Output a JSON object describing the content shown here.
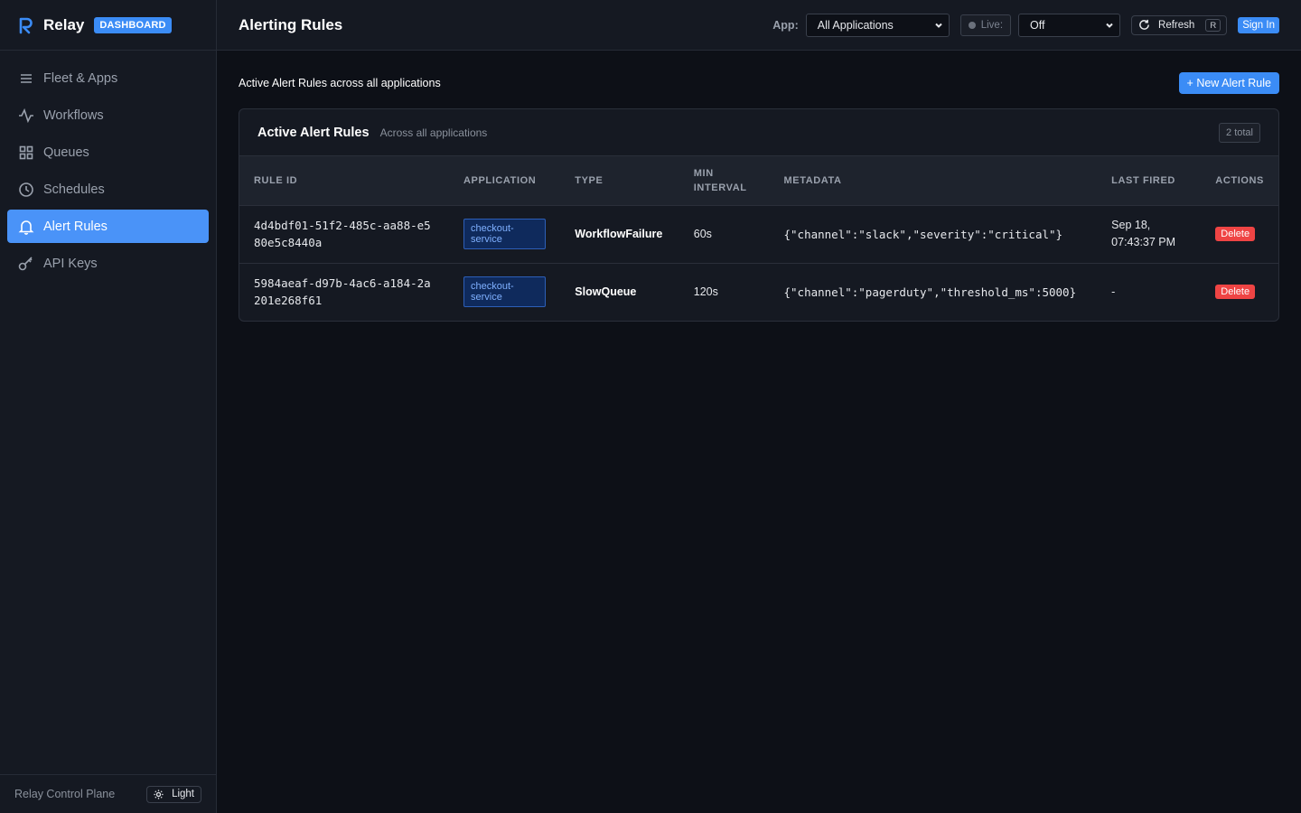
{
  "brand": {
    "name": "Relay",
    "badge": "DASHBOARD",
    "logo": "R"
  },
  "sidebar": {
    "items": [
      {
        "label": "Fleet & Apps",
        "icon": "menu-icon"
      },
      {
        "label": "Workflows",
        "icon": "activity-icon"
      },
      {
        "label": "Queues",
        "icon": "grid-icon"
      },
      {
        "label": "Schedules",
        "icon": "clock-icon"
      },
      {
        "label": "Alert Rules",
        "icon": "bell-icon",
        "active": true
      },
      {
        "label": "API Keys",
        "icon": "key-icon"
      }
    ],
    "footer_label": "Relay Control Plane",
    "theme_toggle_label": "Light"
  },
  "header": {
    "title": "Alerting Rules",
    "app_label": "App:",
    "app_select_value": "All Applications",
    "live_label": "Live:",
    "live_select_value": "Off",
    "refresh_label": "Refresh",
    "refresh_shortcut": "R",
    "signin_label": "Sign In"
  },
  "main": {
    "subtitle": "Active Alert Rules across all applications",
    "new_button_label": "+ New Alert Rule",
    "card": {
      "title": "Active Alert Rules",
      "subtitle": "Across all applications",
      "total_badge": "2 total",
      "columns": [
        "RULE ID",
        "APPLICATION",
        "TYPE",
        "MIN INTERVAL",
        "METADATA",
        "LAST FIRED",
        "ACTIONS"
      ],
      "rows": [
        {
          "rule_id": "4d4bdf01-51f2-485c-aa88-e580e5c8440a",
          "application": "checkout-service",
          "type": "WorkflowFailure",
          "min_interval": "60s",
          "metadata": "{\"channel\":\"slack\",\"severity\":\"critical\"}",
          "last_fired": "Sep 18, 07:43:37 PM",
          "action": "Delete"
        },
        {
          "rule_id": "5984aeaf-d97b-4ac6-a184-2a201e268f61",
          "application": "checkout-service",
          "type": "SlowQueue",
          "min_interval": "120s",
          "metadata": "{\"channel\":\"pagerduty\",\"threshold_ms\":5000}",
          "last_fired": "-",
          "action": "Delete"
        }
      ]
    }
  },
  "colors": {
    "accent": "#3b8cf6",
    "background": "#0d1017",
    "panel": "#151922",
    "danger": "#ef4444",
    "tag_bg": "#0f2a5c",
    "tag_text": "#7fb0ff"
  }
}
